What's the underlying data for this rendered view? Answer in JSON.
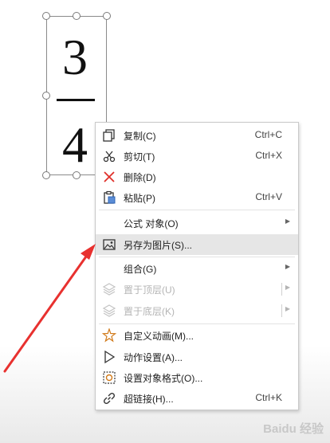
{
  "equation": {
    "numerator": "3",
    "denominator": "4"
  },
  "menu": {
    "items": [
      {
        "label": "复制(C)",
        "shortcut": "Ctrl+C",
        "icon": "copy-icon"
      },
      {
        "label": "剪切(T)",
        "shortcut": "Ctrl+X",
        "icon": "scissors-icon"
      },
      {
        "label": "删除(D)",
        "shortcut": "",
        "icon": "delete-x-icon"
      },
      {
        "label": "粘贴(P)",
        "shortcut": "Ctrl+V",
        "icon": "paste-icon"
      },
      {
        "label": "公式 对象(O)",
        "shortcut": "",
        "icon": "",
        "submenu": true
      },
      {
        "label": "另存为图片(S)...",
        "shortcut": "",
        "icon": "image-icon",
        "highlighted": true
      },
      {
        "label": "组合(G)",
        "shortcut": "",
        "icon": "",
        "submenu": true
      },
      {
        "label": "置于顶层(U)",
        "shortcut": "",
        "icon": "layers-icon",
        "submenu": true,
        "disabled": true
      },
      {
        "label": "置于底层(K)",
        "shortcut": "",
        "icon": "layers-icon",
        "submenu": true,
        "disabled": true
      },
      {
        "label": "自定义动画(M)...",
        "shortcut": "",
        "icon": "star-burst-icon"
      },
      {
        "label": "动作设置(A)...",
        "shortcut": "",
        "icon": "play-triangle-icon"
      },
      {
        "label": "设置对象格式(O)...",
        "shortcut": "",
        "icon": "format-object-icon"
      },
      {
        "label": "超链接(H)...",
        "shortcut": "Ctrl+K",
        "icon": "link-icon"
      }
    ]
  },
  "annotation": {
    "arrow_color": "#e8312f"
  },
  "watermark": "Baidu 经验"
}
